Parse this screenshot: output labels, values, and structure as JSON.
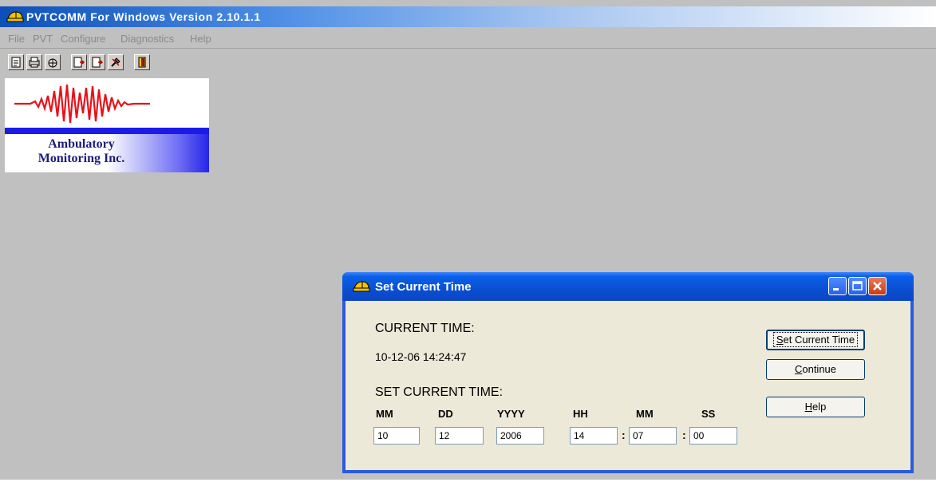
{
  "main_window": {
    "title": "PVTCOMM For Windows  Version 2.10.1.1",
    "menu": [
      "File",
      "PVT",
      "Configure",
      "Diagnostics",
      "Help"
    ],
    "toolbar_icons": [
      "document-icon",
      "print-setup-icon",
      "lock-icon",
      "import-icon",
      "export-icon",
      "tools-icon",
      "exit-door-icon"
    ],
    "logo": {
      "line1": "Ambulatory",
      "line2": "Monitoring Inc.",
      "wave_color": "#e8121a",
      "strip_color": "#1b1be8"
    }
  },
  "dialog": {
    "title": "Set Current Time",
    "current_time_heading": "CURRENT TIME:",
    "current_time_value": "10-12-06 14:24:47",
    "set_time_heading": "SET CURRENT TIME:",
    "fields": [
      {
        "label": "MM",
        "value": "10"
      },
      {
        "label": "DD",
        "value": "12"
      },
      {
        "label": "YYYY",
        "value": "2006"
      },
      {
        "label": "HH",
        "value": "14"
      },
      {
        "label": "MM",
        "value": "07"
      },
      {
        "label": "SS",
        "value": "00"
      }
    ],
    "separators": [
      ":",
      ":"
    ],
    "buttons": {
      "set_current_time": {
        "mnemonic": "S",
        "rest": "et Current Time"
      },
      "continue": {
        "mnemonic": "C",
        "rest": "ontinue"
      },
      "help": {
        "mnemonic": "H",
        "rest": "elp"
      }
    }
  }
}
